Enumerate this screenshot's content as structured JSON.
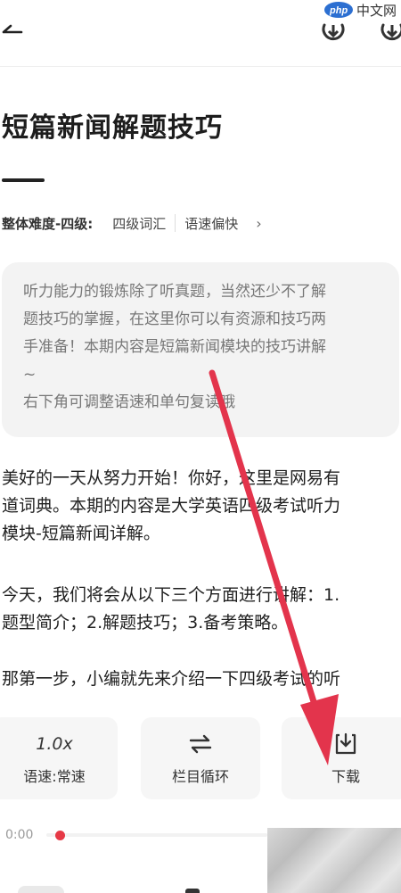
{
  "header": {
    "back_icon": "back-arrow-icon",
    "icons": [
      "refresh-icon",
      "download-icon"
    ]
  },
  "watermark": {
    "brand": "php",
    "site": "中文网"
  },
  "article": {
    "title": "短篇新闻解题技巧",
    "meta": {
      "difficulty": "整体难度-四级:",
      "tags": [
        "四级词汇",
        "语速偏快"
      ]
    },
    "intro": [
      "听力能力的锻炼除了听真题，当然还少不了解",
      "题技巧的掌握，在这里你可以有资源和技巧两",
      "手准备！本期内容是短篇新闻模块的技巧讲解",
      "~",
      "右下角可调整语速和单句复读哦"
    ],
    "paragraphs": [
      [
        "美好的一天从努力开始！你好，这里是网易有",
        "道词典。本期的内容是大学英语四级考试听力",
        "模块-短篇新闻详解。"
      ],
      [
        "今天，我们将会从以下三个方面进行讲解：1.",
        "题型简介；2.解题技巧；3.备考策略。"
      ],
      [
        "那第一步，小编就先来介绍一下四级考试的听"
      ]
    ]
  },
  "controls": {
    "speed_value": "1.0x",
    "speed_label": "语速:常速",
    "loop_label": "栏目循环",
    "download_label": "下载"
  },
  "player": {
    "time": "0:00",
    "progress": 0.04
  },
  "colors": {
    "accent": "#e63946",
    "arrow": "#e3344c"
  }
}
